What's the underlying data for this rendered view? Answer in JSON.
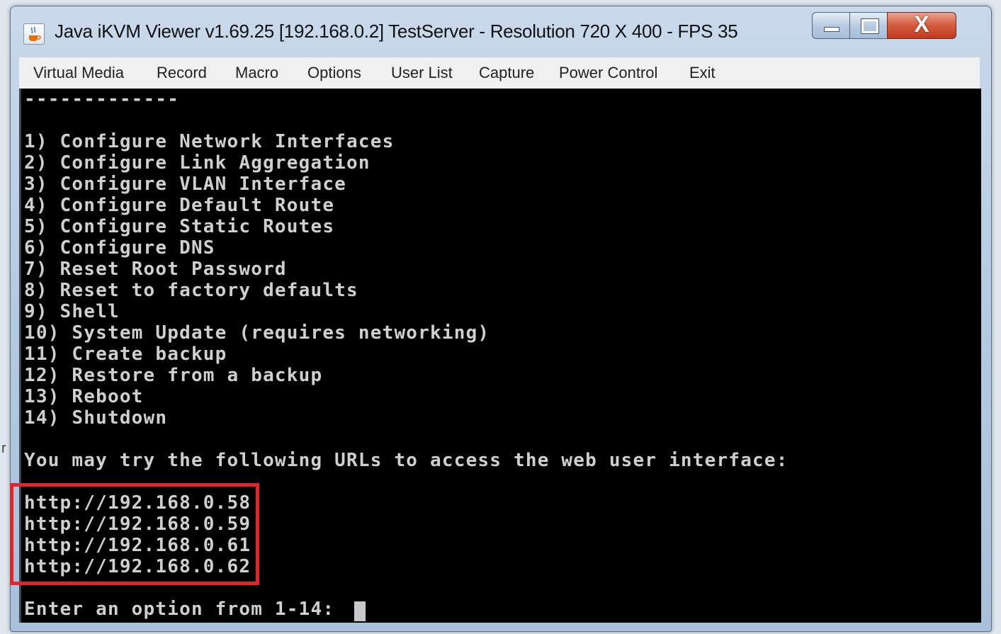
{
  "window": {
    "title": "Java iKVM Viewer v1.69.25 [192.168.0.2] TestServer - Resolution 720 X 400 - FPS 35",
    "icon": "java-coffee-icon",
    "controls": {
      "close_label": "X"
    }
  },
  "menu": [
    {
      "label": "Virtual Media"
    },
    {
      "label": "Record"
    },
    {
      "label": "Macro"
    },
    {
      "label": "Options"
    },
    {
      "label": "User List"
    },
    {
      "label": "Capture"
    },
    {
      "label": "Power Control"
    },
    {
      "label": "Exit"
    }
  ],
  "console": {
    "separator": "-------------",
    "options": [
      "1) Configure Network Interfaces",
      "2) Configure Link Aggregation",
      "3) Configure VLAN Interface",
      "4) Configure Default Route",
      "5) Configure Static Routes",
      "6) Configure DNS",
      "7) Reset Root Password",
      "8) Reset to factory defaults",
      "9) Shell",
      "10) System Update (requires networking)",
      "11) Create backup",
      "12) Restore from a backup",
      "13) Reboot",
      "14) Shutdown"
    ],
    "url_intro": "You may try the following URLs to access the web user interface:",
    "urls": [
      "http://192.168.0.58",
      "http://192.168.0.59",
      "http://192.168.0.61",
      "http://192.168.0.62"
    ],
    "prompt": "Enter an option from 1-14: "
  },
  "colors": {
    "terminal_bg": "#000000",
    "terminal_fg": "#cfcfcf",
    "highlight_border": "#e0262b"
  },
  "side_text": "r"
}
